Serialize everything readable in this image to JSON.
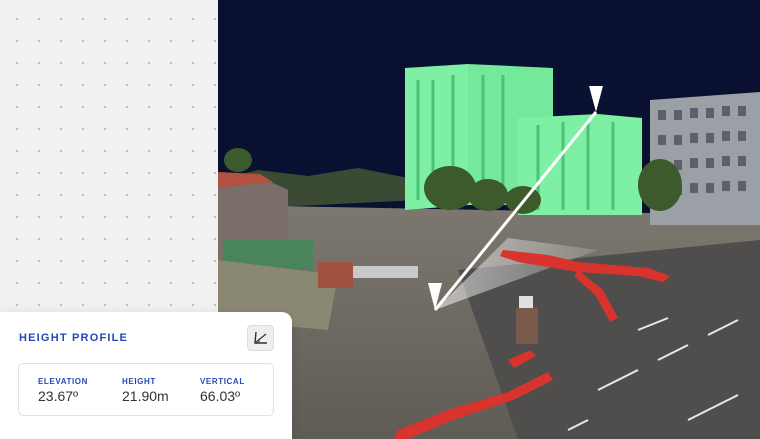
{
  "panel": {
    "title": "HEIGHT PROFILE",
    "tool_icon": "angle-measure-icon"
  },
  "metrics": [
    {
      "label": "ELEVATION",
      "value": "23.67º"
    },
    {
      "label": "HEIGHT",
      "value": "21.90m"
    },
    {
      "label": "VERTICAL",
      "value": "66.03º"
    }
  ],
  "colors": {
    "accent": "#2647b5",
    "building_highlight": "#7ef0a4",
    "sky": "#0a1030",
    "barrier_red": "#d8332c"
  }
}
